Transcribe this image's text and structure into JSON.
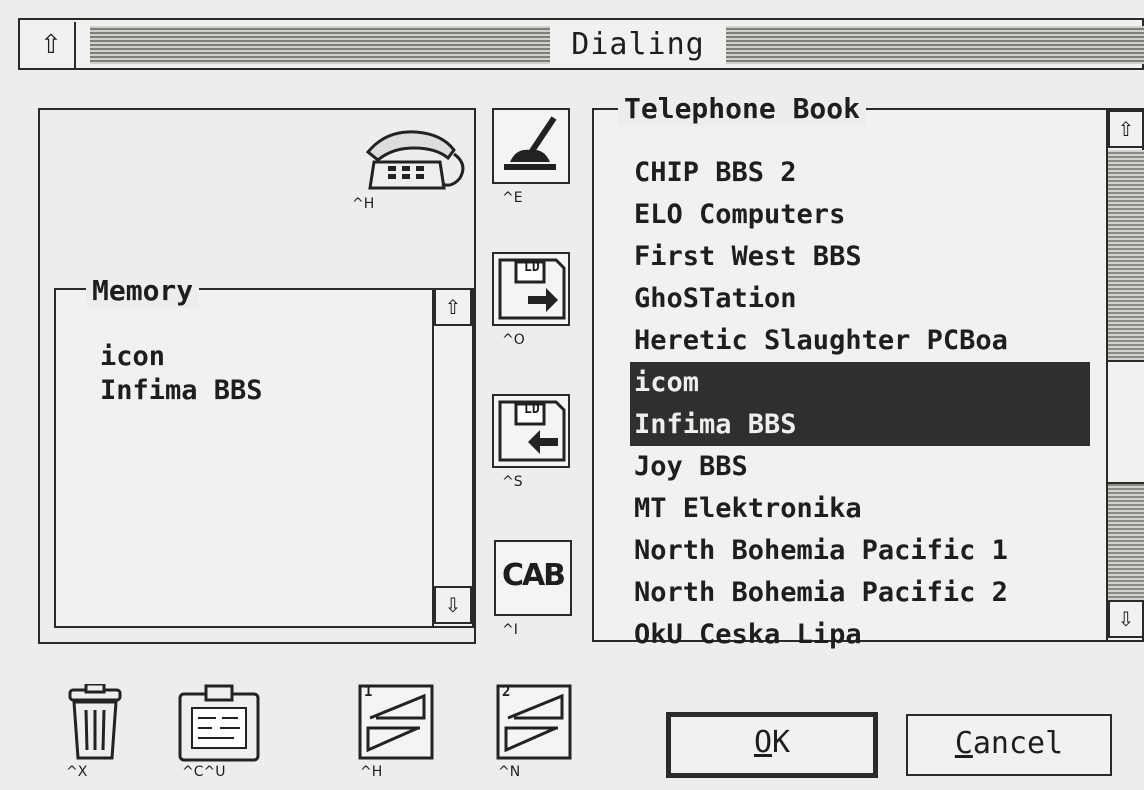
{
  "window": {
    "title": "Dialing",
    "close_icon": "close-box-icon"
  },
  "dial_panel": {
    "phone_icon": "telephone-icon",
    "phone_shortcut": "^H"
  },
  "memory": {
    "label": "Memory",
    "items": [
      "icon",
      "Infima BBS"
    ],
    "scroll_up_icon": "⇧",
    "scroll_down_icon": "⇩"
  },
  "tools": [
    {
      "icon": "edit-pen-icon",
      "shortcut": "^E"
    },
    {
      "icon": "disk-load-icon",
      "shortcut": "^O",
      "disk_label": "LD"
    },
    {
      "icon": "disk-save-icon",
      "shortcut": "^S",
      "disk_label": "LD"
    },
    {
      "icon": "cab-icon",
      "shortcut": "^I",
      "label": "CAB"
    }
  ],
  "telephone_book": {
    "label": "Telephone Book",
    "entries": [
      {
        "name": "CHIP BBS 2",
        "selected": false
      },
      {
        "name": "ELO Computers",
        "selected": false
      },
      {
        "name": "First West BBS",
        "selected": false
      },
      {
        "name": "GhoSTation",
        "selected": false
      },
      {
        "name": "Heretic Slaughter PCBoa",
        "selected": false
      },
      {
        "name": "icom",
        "selected": true
      },
      {
        "name": "Infima BBS",
        "selected": true
      },
      {
        "name": "Joy BBS",
        "selected": false
      },
      {
        "name": "MT Elektronika",
        "selected": false
      },
      {
        "name": "North Bohemia Pacific 1",
        "selected": false
      },
      {
        "name": "North Bohemia Pacific 2",
        "selected": false
      },
      {
        "name": "OkU Ceska Lipa",
        "selected": false
      }
    ],
    "scroll_up_icon": "⇧",
    "scroll_down_icon": "⇩"
  },
  "bottom_tools": [
    {
      "icon": "trash-can-icon",
      "shortcut": "^X"
    },
    {
      "icon": "clipboard-icon",
      "shortcut": "^C^U"
    },
    {
      "icon": "modem-1-icon",
      "shortcut": "^H",
      "number": "1"
    },
    {
      "icon": "modem-2-icon",
      "shortcut": "^N",
      "number": "2"
    }
  ],
  "buttons": {
    "ok_hot": "O",
    "ok_rest": "K",
    "cancel_hot": "C",
    "cancel_rest": "ancel"
  }
}
